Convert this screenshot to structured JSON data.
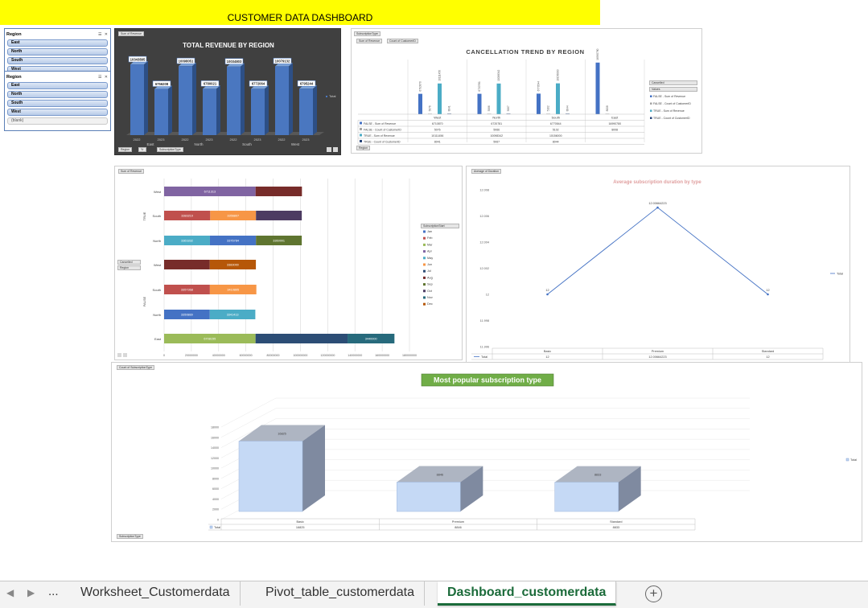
{
  "dashboard_title": "CUSTOMER DATA DASHBOARD",
  "slicers": [
    {
      "title": "Region",
      "items": [
        "East",
        "North",
        "South",
        "West"
      ]
    },
    {
      "title": "Region",
      "items": [
        "East",
        "North",
        "South",
        "West",
        "(blank)"
      ]
    }
  ],
  "chart_data": [
    {
      "id": "revenue",
      "type": "bar",
      "title": "TOTAL REVENUE BY REGION",
      "field_buttons": [
        "Sum of Revenue"
      ],
      "axis_buttons": [
        "Region",
        "Yr",
        "SubscriptionType"
      ],
      "groups": [
        {
          "region": "East",
          "years": [
            "2022",
            "2023"
          ]
        },
        {
          "region": "North",
          "years": [
            "2022",
            "2023"
          ]
        },
        {
          "region": "South",
          "years": [
            "2022",
            "2023"
          ]
        },
        {
          "region": "West",
          "years": [
            "2022",
            "2023"
          ]
        }
      ],
      "values": [
        10343895,
        6756208,
        10098051,
        6780021,
        10034803,
        6772064,
        10079132,
        6795244
      ],
      "data_labels": [
        "10343895",
        "6756208",
        "10098051",
        "6780021",
        "10034803",
        "6772064",
        "10079132",
        "6795244"
      ],
      "legend": [
        "Total"
      ],
      "ylim": [
        0,
        12000000
      ]
    },
    {
      "id": "cancellation",
      "type": "bar",
      "title": "CANCELLATION TREND BY REGION",
      "field_buttons": [
        "SubscriptionType",
        "Sum of Revenue",
        "Count of CustomerID"
      ],
      "legend_button": "Cancelled",
      "sub_button": "Values",
      "axis_button": "Region",
      "categories": [
        "West",
        "North",
        "South",
        "East"
      ],
      "series": [
        {
          "name": "FALSE - Sum of Revenue",
          "color": "#4472c4",
          "values": [
            6710870,
            6720781,
            6770544,
            16990780
          ],
          "labels": [
            "6710870",
            "6720781",
            "6770544",
            "16990780"
          ]
        },
        {
          "name": "FALSE - Count of CustomerID",
          "color": "#a5a5a5",
          "values": [
            5076,
            5066,
            5102,
            8008
          ],
          "labels": [
            "5076",
            "5066",
            "5102",
            "8008"
          ]
        },
        {
          "name": "TRUE - Sum of Revenue",
          "color": "#4bacc6",
          "values": [
            10111456,
            10098342,
            10156000,
            0
          ],
          "labels": [
            "10111456",
            "10098342",
            "10156000",
            ""
          ]
        },
        {
          "name": "TRUE - Count of CustomerID",
          "color": "#264478",
          "values": [
            8041,
            5067,
            8044,
            0
          ],
          "labels": [
            "8041",
            "5067",
            "8044",
            ""
          ]
        }
      ],
      "table": [
        [
          "FALSE - Sum of Revenue",
          "6710870",
          "6720781",
          "6770544",
          "16990780"
        ],
        [
          "FALSE - Count of CustomerID",
          "5076",
          "5066",
          "5102",
          "8008"
        ],
        [
          "TRUE - Sum of Revenue",
          "10111456",
          "10098342",
          "10156000",
          ""
        ],
        [
          "TRUE - Count of CustomerID",
          "8041",
          "5067",
          "8044",
          ""
        ]
      ],
      "ylim": [
        0,
        18000000
      ]
    },
    {
      "id": "monthly",
      "type": "bar",
      "orientation": "horizontal-stacked",
      "field_button": "Sum of Revenue",
      "legend_button": "SubscriptionStart",
      "axis_buttons": [
        "Cancelled",
        "Region"
      ],
      "groups": [
        {
          "name": "TRUE",
          "rows": [
            "West",
            "South",
            "North"
          ]
        },
        {
          "name": "FALSE",
          "rows": [
            "West",
            "South",
            "North",
            "East"
          ]
        }
      ],
      "months": [
        "Jan",
        "Feb",
        "Mar",
        "Apr",
        "May",
        "Jun",
        "Jul",
        "Aug",
        "Sep",
        "Oct",
        "Nov",
        "Dec"
      ],
      "month_colors": [
        "#4472c4",
        "#c0504d",
        "#9bbb59",
        "#8064a2",
        "#4bacc6",
        "#f79646",
        "#2c4d75",
        "#772c2a",
        "#5f7530",
        "#4d3b62",
        "#276a7c",
        "#b65708"
      ],
      "rows": [
        {
          "segments": [
            {
              "month": 3,
              "value": 6711313,
              "label": "6711313"
            },
            {
              "month": 7,
              "value": 3400000,
              "label": ""
            }
          ]
        },
        {
          "segments": [
            {
              "month": 1,
              "value": 3383210,
              "label": "3383210"
            },
            {
              "month": 5,
              "value": 3356807,
              "label": "3356807"
            },
            {
              "month": 9,
              "value": 3360000,
              "label": ""
            }
          ]
        },
        {
          "segments": [
            {
              "month": 4,
              "value": 3361832,
              "label": "3361832"
            },
            {
              "month": 0,
              "value": 3376784,
              "label": "3376784"
            },
            {
              "month": 8,
              "value": 3360001,
              "label": "3360001"
            }
          ]
        },
        {
          "segments": [
            {
              "month": 7,
              "value": 3350000,
              "label": ""
            },
            {
              "month": 11,
              "value": 3383000,
              "label": "3383000"
            }
          ]
        },
        {
          "segments": [
            {
              "month": 1,
              "value": 3357368,
              "label": "3357368"
            },
            {
              "month": 5,
              "value": 3410895,
              "label": "3410895"
            }
          ]
        },
        {
          "segments": [
            {
              "month": 0,
              "value": 3350889,
              "label": "3350889"
            },
            {
              "month": 4,
              "value": 3341413,
              "label": "3341413"
            }
          ]
        },
        {
          "segments": [
            {
              "month": 2,
              "value": 6708155,
              "label": "6708155"
            },
            {
              "month": 6,
              "value": 6750000,
              "label": ""
            },
            {
              "month": 10,
              "value": 3440000,
              "label": "3440000"
            }
          ]
        }
      ],
      "xticks": [
        "0",
        "20000000",
        "40000000",
        "60000000",
        "80000000",
        "100000000",
        "120000000",
        "140000000",
        "160000000",
        "180000000"
      ],
      "xlim": [
        0,
        18000000
      ]
    },
    {
      "id": "duration",
      "type": "line",
      "title": "Average subscription duration by type",
      "field_button": "Average of Duration",
      "axis_button": "SubscriptionType",
      "categories": [
        "Basic",
        "Premium",
        "Standard"
      ],
      "values": [
        12,
        12.00664223,
        12
      ],
      "data_labels": [
        "12",
        "12.00664223",
        "12"
      ],
      "table_values": [
        "12",
        "12.00664223",
        "12"
      ],
      "yticks": [
        "12.008",
        "12.006",
        "12.004",
        "12.002",
        "12",
        "11.998",
        "11.996"
      ],
      "ylim": [
        11.996,
        12.008
      ],
      "legend": [
        "Total"
      ],
      "color": "#4472c4"
    },
    {
      "id": "popular",
      "type": "bar",
      "title": "Most popular subscription type",
      "field_button": "Count of SubscriptionType",
      "axis_button": "SubscriptionType",
      "categories": [
        "Basic",
        "Premium",
        "Standard"
      ],
      "values": [
        16825,
        8846,
        8833
      ],
      "data_labels": [
        "16825",
        "8846",
        "8833"
      ],
      "table_values": [
        "16825",
        "8846",
        "8833"
      ],
      "yticks": [
        "18000",
        "16000",
        "14000",
        "12000",
        "10000",
        "8000",
        "6000",
        "4000",
        "2000",
        "0"
      ],
      "ylim": [
        0,
        18000
      ],
      "legend": [
        "Total"
      ]
    }
  ],
  "sheet_tabs": {
    "more": "...",
    "tabs": [
      "Worksheet_Customerdata",
      "Pivot_table_customerdata",
      "Dashboard_customerdata"
    ],
    "active_index": 2,
    "add_label": "+"
  }
}
